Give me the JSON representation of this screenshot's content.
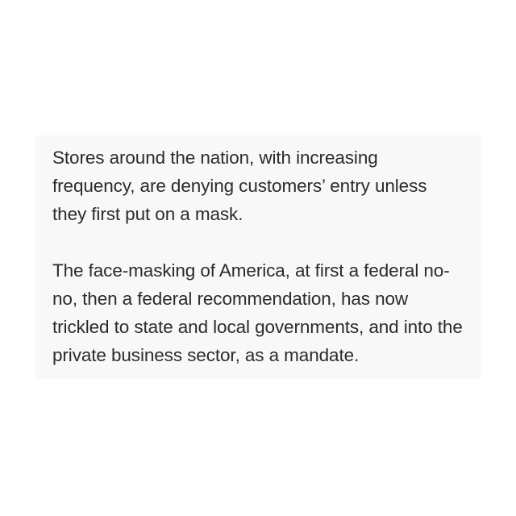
{
  "article": {
    "paragraphs": [
      "Stores around the nation, with increasing frequency, are denying customers’ entry unless they first put on a mask.",
      "The face-masking of America, at first a federal no-no, then a federal recommendation, has now trickled to state and local governments, and into the private business sector, as a mandate."
    ]
  },
  "colors": {
    "background": "#ffffff",
    "card_background": "#f8f8f8",
    "text": "#2b2b2b"
  }
}
